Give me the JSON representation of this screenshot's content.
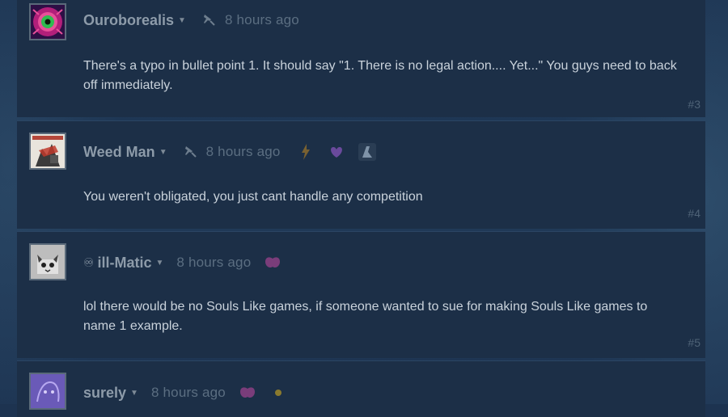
{
  "comments": [
    {
      "author": "Ouroborealis",
      "time": "8 hours ago",
      "text": "There's a typo in bullet point 1. It should say \"1. There is no legal action.... Yet...\" You guys need to back off immediately.",
      "number": "#3",
      "avatar": "green-eye-avatar"
    },
    {
      "author": "Weed Man",
      "time": "8 hours ago",
      "text": "You weren't obligated, you just cant handle any competition",
      "number": "#4",
      "avatar": "poster-avatar",
      "awards": [
        "lightning-award-icon",
        "heart-award-icon",
        "letter-award-icon"
      ]
    },
    {
      "author": "ill-Matic",
      "time": "8 hours ago",
      "text": "lol there would be no Souls Like games, if someone wanted to sue for making Souls Like games to name 1 example.",
      "number": "#5",
      "avatar": "cat-avatar",
      "awards": [
        "purple-blob-award-icon"
      ]
    },
    {
      "author": "surely",
      "time": "8 hours ago",
      "avatar": "sketch-avatar",
      "awards": [
        "purple-blob-award-icon",
        "gold-dot-award-icon"
      ]
    }
  ],
  "colors": {
    "panel": "#1c2f47",
    "author": "#8d9ba9",
    "body_text": "#c9d2db",
    "timestamp": "#5b6e81"
  },
  "icons": [
    "caret-down-icon",
    "pin-icon",
    "friends-icon"
  ]
}
